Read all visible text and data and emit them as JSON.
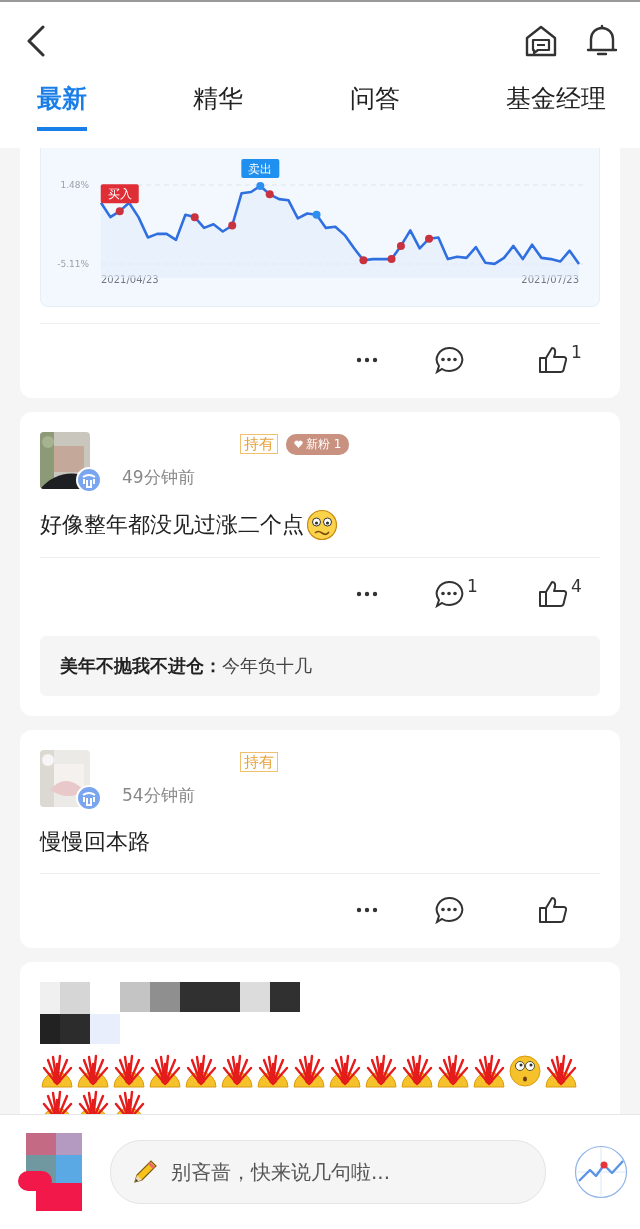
{
  "header": {
    "tabs": [
      {
        "label": "最新",
        "selected": true
      },
      {
        "label": "精华",
        "selected": false
      },
      {
        "label": "问答",
        "selected": false
      },
      {
        "label": "基金经理",
        "selected": false
      }
    ]
  },
  "posts": [
    {
      "kind": "chart",
      "like_count": "1",
      "date_start": "2021/04/23",
      "date_end": "2021/07/23",
      "trade_labels": {
        "buy": "买入",
        "sell": "卖出"
      },
      "trade_points": [
        {
          "kind": "none"
        },
        {
          "kind": "none"
        },
        {
          "kind": "buy"
        },
        {
          "kind": "none"
        },
        {
          "kind": "none"
        },
        {
          "kind": "none"
        },
        {
          "kind": "none"
        },
        {
          "kind": "none"
        },
        {
          "kind": "none"
        },
        {
          "kind": "none"
        },
        {
          "kind": "buy"
        },
        {
          "kind": "none"
        },
        {
          "kind": "none"
        },
        {
          "kind": "none"
        },
        {
          "kind": "buy"
        },
        {
          "kind": "none"
        },
        {
          "kind": "none"
        },
        {
          "kind": "sell"
        },
        {
          "kind": "buy"
        },
        {
          "kind": "none"
        },
        {
          "kind": "none"
        },
        {
          "kind": "none"
        },
        {
          "kind": "none"
        },
        {
          "kind": "sell"
        },
        {
          "kind": "none"
        },
        {
          "kind": "none"
        },
        {
          "kind": "none"
        },
        {
          "kind": "none"
        },
        {
          "kind": "buy"
        },
        {
          "kind": "none"
        },
        {
          "kind": "none"
        },
        {
          "kind": "buy"
        },
        {
          "kind": "buy"
        },
        {
          "kind": "none"
        },
        {
          "kind": "none"
        },
        {
          "kind": "buy"
        },
        {
          "kind": "none"
        },
        {
          "kind": "none"
        },
        {
          "kind": "none"
        },
        {
          "kind": "none"
        },
        {
          "kind": "none"
        },
        {
          "kind": "none"
        },
        {
          "kind": "none"
        },
        {
          "kind": "none"
        },
        {
          "kind": "none"
        },
        {
          "kind": "none"
        },
        {
          "kind": "none"
        },
        {
          "kind": "none"
        },
        {
          "kind": "none"
        },
        {
          "kind": "none"
        },
        {
          "kind": "none"
        },
        {
          "kind": "none"
        }
      ],
      "chart_data": {
        "type": "area",
        "series": [
          {
            "color": "#2f6fe0",
            "values": [
              0.0,
              -1.2,
              -0.7,
              0.0,
              -1.2,
              -2.9,
              -2.6,
              -2.6,
              -3.1,
              -1.0,
              -1.2,
              -2.1,
              -1.8,
              -2.4,
              -1.9,
              0.8,
              0.9,
              1.4,
              0.7,
              0.3,
              0.2,
              -1.3,
              -0.9,
              -1.0,
              -2.1,
              -2.0,
              -2.7,
              -3.8,
              -4.8,
              -4.7,
              -4.7,
              -4.7,
              -3.6,
              -2.3,
              -3.8,
              -3.0,
              -2.9,
              -4.7,
              -4.5,
              -4.6,
              -3.7,
              -5.0,
              -5.1,
              -4.6,
              -3.6,
              -4.7,
              -3.5,
              -4.6,
              -4.7,
              -4.9,
              -4.0,
              -5.1
            ]
          }
        ],
        "ylim": [
          -5.11,
          1.48
        ],
        "yticks": [
          {
            "value": 1.48,
            "label": "1.48%"
          },
          {
            "value": -5.11,
            "label": "-5.11%"
          }
        ]
      }
    },
    {
      "kind": "text",
      "holding_tag": "持有",
      "fan_badge": "新粉 1",
      "time": "49分钟前",
      "text": "好像整年都没见过涨二个点",
      "text_emoji": {
        "kind": "woozy"
      },
      "comment_count": "1",
      "like_count": "4",
      "reply": "**美年不抛我不进仓：**今年负十几"
    },
    {
      "kind": "text",
      "holding_tag": "持有",
      "time": "54分钟前",
      "text": "慢慢回本路"
    },
    {
      "kind": "emoji",
      "emojis": [
        {
          "kind": "explode"
        },
        {
          "kind": "explode"
        },
        {
          "kind": "explode"
        },
        {
          "kind": "explode"
        },
        {
          "kind": "explode"
        },
        {
          "kind": "explode"
        },
        {
          "kind": "explode"
        },
        {
          "kind": "explode"
        },
        {
          "kind": "explode"
        },
        {
          "kind": "explode"
        },
        {
          "kind": "explode"
        },
        {
          "kind": "explode"
        },
        {
          "kind": "explode"
        },
        {
          "kind": "surprised"
        },
        {
          "kind": "explode"
        },
        {
          "kind": "explode"
        },
        {
          "kind": "explode"
        },
        {
          "kind": "explode"
        }
      ]
    }
  ],
  "composer": {
    "placeholder": "别吝啬，快来说几句啦..."
  }
}
